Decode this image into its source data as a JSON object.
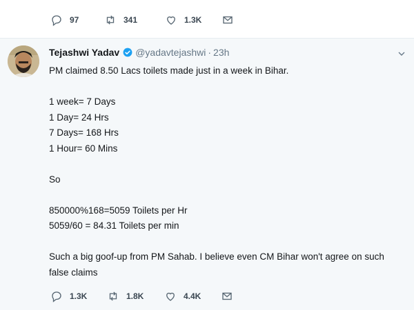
{
  "top_actions": {
    "reply_count": "97",
    "retweet_count": "341",
    "like_count": "1.3K"
  },
  "tweet": {
    "author_name": "Tejashwi Yadav",
    "handle": "@yadavtejashwi",
    "separator": "·",
    "time": "23h",
    "lines": {
      "l1": "PM claimed 8.50 Lacs toilets made just in a week in Bihar.",
      "l2": "1 week= 7 Days",
      "l3": "1 Day= 24 Hrs",
      "l4": "7 Days= 168 Hrs",
      "l5": "1 Hour= 60 Mins",
      "l6": "So",
      "l7": "850000%168=5059 Toilets per Hr",
      "l8": "5059/60 = 84.31 Toilets per min",
      "l9": "Such a big goof-up from PM Sahab. I believe even CM Bihar won't agree on such",
      "l10": "false claims"
    },
    "actions": {
      "reply_count": "1.3K",
      "retweet_count": "1.8K",
      "like_count": "4.4K"
    }
  },
  "colors": {
    "tweet_bg": "#f5f8fa",
    "verified_blue": "#1da1f2",
    "text_secondary": "#657786"
  }
}
